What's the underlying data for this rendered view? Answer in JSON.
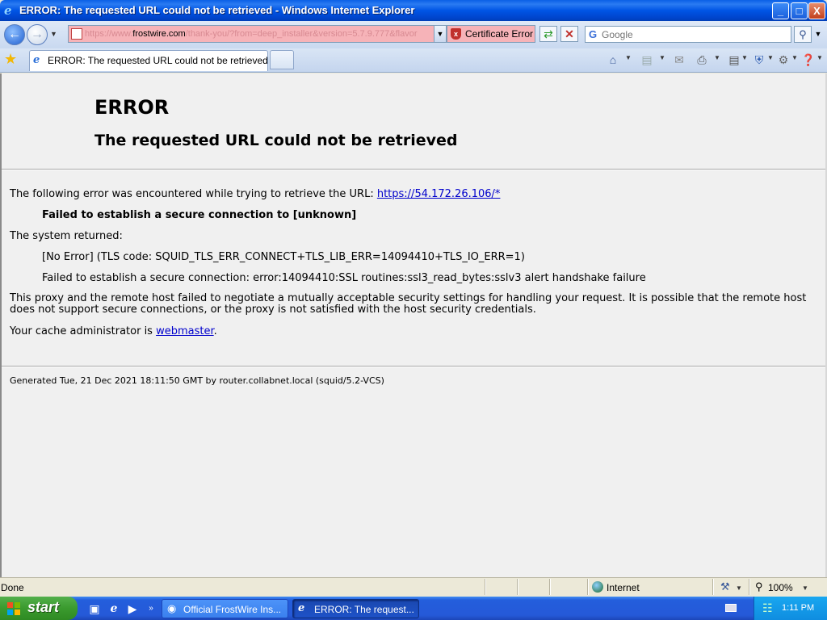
{
  "window": {
    "title": "ERROR: The requested URL could not be retrieved - Windows Internet Explorer",
    "minimize": "_",
    "maximize": "□",
    "close": "X"
  },
  "address": {
    "url_prefix": "https://www.",
    "url_host": "frostwire.com",
    "url_suffix": "/thank-you/?from=deep_installer&version=5.7.9.777&flavor",
    "certificate_label": "Certificate Error"
  },
  "search": {
    "placeholder": "Google"
  },
  "tabs": [
    {
      "label": "ERROR: The requested URL could not be retrieved"
    }
  ],
  "page": {
    "heading": "ERROR",
    "subheading": "The requested URL could not be retrieved",
    "line1_text": "The following error was encountered while trying to retrieve the URL: ",
    "line1_link": "https://54.172.26.106/*",
    "line2": "Failed to establish a secure connection to [unknown]",
    "line3": "The system returned:",
    "line4": "[No Error] (TLS code: SQUID_TLS_ERR_CONNECT+TLS_LIB_ERR=14094410+TLS_IO_ERR=1)",
    "line5": "Failed to establish a secure connection: error:14094410:SSL routines:ssl3_read_bytes:sslv3 alert handshake failure",
    "line6": "This proxy and the remote host failed to negotiate a mutually acceptable security settings for handling your request. It is possible that the remote host does not support secure connections, or the proxy is not satisfied with the host security credentials.",
    "line7_text": "Your cache administrator is ",
    "line7_link": "webmaster",
    "line7_end": ".",
    "footer": "Generated Tue, 21 Dec 2021 18:11:50 GMT by router.collabnet.local (squid/5.2-VCS)"
  },
  "status": {
    "text": "Done",
    "zone": "Internet",
    "zoom": "100%"
  },
  "taskbar": {
    "start": "start",
    "tasks": [
      {
        "label": "Official FrostWire Ins..."
      },
      {
        "label": "ERROR: The request..."
      }
    ],
    "clock": "1:11 PM"
  }
}
